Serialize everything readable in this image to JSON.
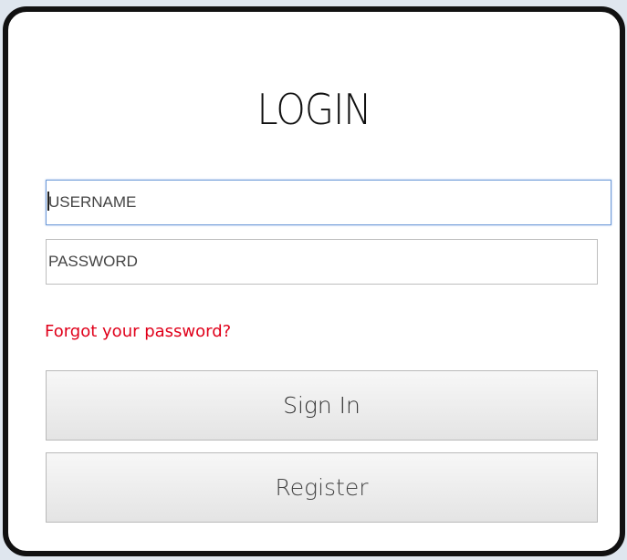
{
  "login_form": {
    "title": "LOGIN",
    "username": {
      "value": "",
      "placeholder": "USERNAME"
    },
    "password": {
      "value": "",
      "placeholder": "PASSWORD"
    },
    "forgot_link": "Forgot your password?",
    "sign_in_label": "Sign In",
    "register_label": "Register"
  },
  "colors": {
    "link": "#e0001a",
    "focus_border": "#6f9bd8",
    "card_border": "#111111"
  }
}
